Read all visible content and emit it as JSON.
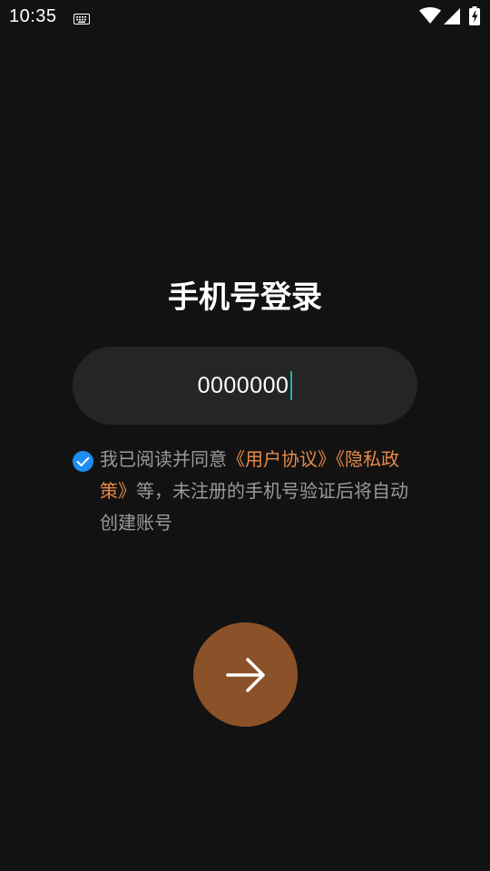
{
  "status_bar": {
    "time": "10:35",
    "icons": [
      "keyboard-icon",
      "wifi-icon",
      "signal-icon",
      "battery-charging-icon"
    ]
  },
  "login": {
    "title": "手机号登录",
    "phone_value": "0000000",
    "agreement": {
      "checked": true,
      "prefix": "我已阅读并同意",
      "user_agreement": "《用户协议》",
      "privacy_policy": "《隐私政策》",
      "suffix": "等，未注册的手机号验证后将自动创建账号"
    },
    "submit_icon": "arrow-right-icon"
  },
  "colors": {
    "background": "#121212",
    "input_background": "#252525",
    "link": "#e8894a",
    "checkbox": "#1e8cf0",
    "submit": "#8b5229",
    "cursor": "#20b2a6"
  }
}
